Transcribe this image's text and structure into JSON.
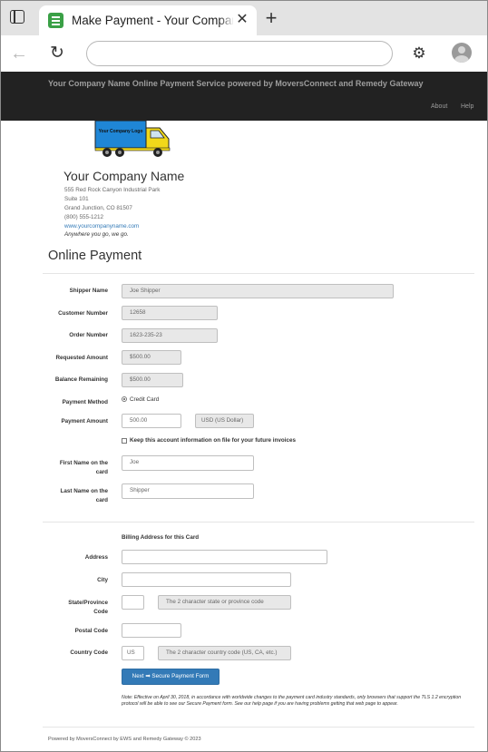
{
  "browser": {
    "tab_title": "Make Payment - Your Company Name",
    "tab_close_glyph": "✕",
    "new_tab_glyph": "+",
    "back_glyph": "←",
    "reload_glyph": "↻",
    "extensions_glyph": "⚙",
    "url": "",
    "favicon_color": "#3aa046"
  },
  "site_header": {
    "brand": "Your Company Name Online Payment Service powered by MoversConnect and Remedy Gateway",
    "nav": [
      "About",
      "Help"
    ],
    "background": "#222222"
  },
  "company": {
    "logo_text": "Your Company Logo",
    "name": "Your Company Name",
    "address_lines": [
      "555 Red Rock Canyon Industrial Park",
      "Suite 101",
      "Grand Junction, CO 81507",
      "(800) 555-1212"
    ],
    "website": "www.yourcompanyname.com",
    "tagline": "Anywhere you go, we go."
  },
  "form": {
    "heading": "Online Payment",
    "shipper_name": {
      "label": "Shipper Name",
      "value": "Joe Shipper"
    },
    "customer_number": {
      "label": "Customer Number",
      "value": "12658"
    },
    "order_number": {
      "label": "Order Number",
      "value": "1623-235-23"
    },
    "requested_amount": {
      "label": "Requested Amount",
      "value": "$500.00"
    },
    "balance_remaining": {
      "label": "Balance Remaining",
      "value": "$500.00"
    },
    "payment_method": {
      "label": "Payment Method",
      "option": "Credit Card"
    },
    "payment_amount": {
      "label": "Payment Amount",
      "value": "500.00",
      "currency": "USD (US Dollar)"
    },
    "keep_on_file": "Keep this account information on file for your future invoices",
    "first_name": {
      "label_line1": "First Name on the",
      "label_line2": "card",
      "value": "Joe"
    },
    "last_name": {
      "label_line1": "Last Name on the",
      "label_line2": "card",
      "value": "Shipper"
    },
    "billing_heading": "Billing Address for this Card",
    "address": {
      "label": "Address",
      "value": ""
    },
    "city": {
      "label": "City",
      "value": ""
    },
    "state": {
      "label_line1": "State/Province",
      "label_line2": "Code",
      "value": "",
      "placeholder": "The 2 character state or province code"
    },
    "postal": {
      "label": "Postal Code",
      "value": ""
    },
    "country": {
      "label": "Country Code",
      "value": "US",
      "placeholder": "The 2 character country code (US, CA, etc.)"
    },
    "next_button": "Next ➡ Secure Payment Form",
    "accent_color": "#337ab7",
    "note": "Note: Effective on April 30, 2018, in accordance with worldwide changes to the payment card industry standards, only browsers that support the TLS 1.2 encryption protocol will be able to see our Secure Payment form. See our help page if you are having problems getting that web page to appear."
  },
  "footer": {
    "text": "Powered by MoversConnect by EWS and Remedy Gateway © 2023"
  }
}
